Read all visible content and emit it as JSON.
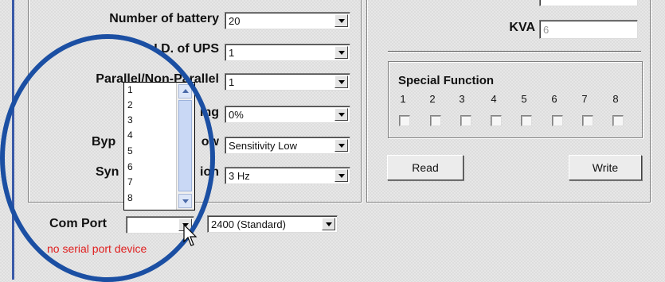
{
  "config": {
    "number_of_battery": {
      "label": "Number of battery",
      "value": "20"
    },
    "ups_id": {
      "label": "I.D. of UPS",
      "value": "1"
    },
    "parallel": {
      "label": "Parallel/Non-Parallel",
      "value": "1"
    },
    "derating": {
      "label": "ing",
      "value": "0%"
    },
    "bypass_window": {
      "label_left": "Byp",
      "label_right": "ow",
      "value": "Sensitivity Low"
    },
    "synchronization": {
      "label_left": "Syn",
      "label_right": "ion",
      "value": "3 Hz"
    }
  },
  "kva": {
    "label": "KVA",
    "value": "6"
  },
  "special_function": {
    "title": "Special Function",
    "numbers": [
      "1",
      "2",
      "3",
      "4",
      "5",
      "6",
      "7",
      "8"
    ]
  },
  "buttons": {
    "read": "Read",
    "write": "Write"
  },
  "com_port": {
    "label": "Com Port",
    "value": "",
    "baud": "2400 (Standard)",
    "status": "no serial port device",
    "status_color": "#e02020"
  },
  "dropdown_options": [
    "1",
    "2",
    "3",
    "4",
    "5",
    "6",
    "7",
    "8"
  ],
  "colors": {
    "annotation_circle": "#1b4fa3"
  }
}
